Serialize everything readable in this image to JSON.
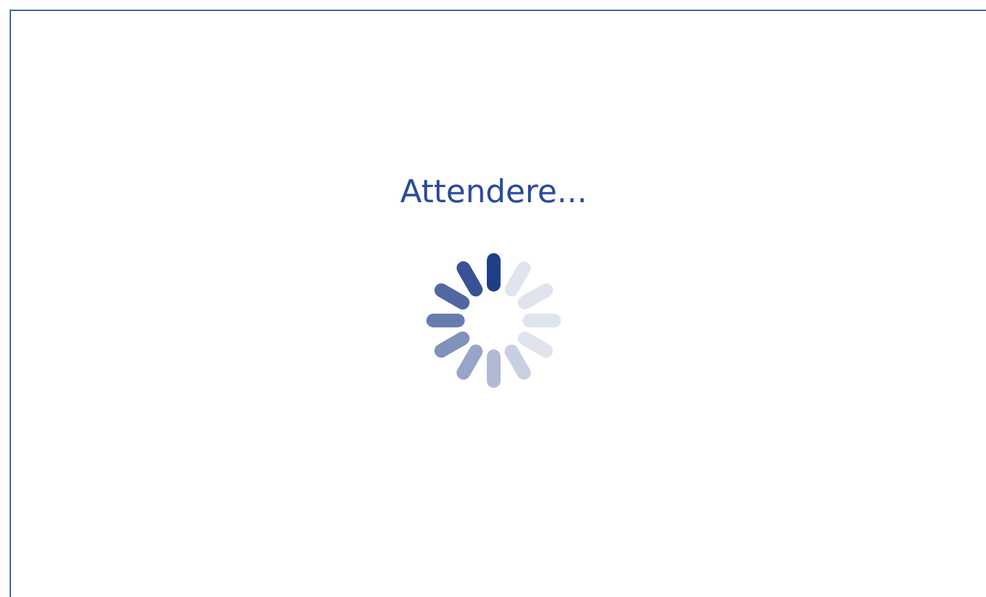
{
  "loading": {
    "message": "Attendere..."
  }
}
